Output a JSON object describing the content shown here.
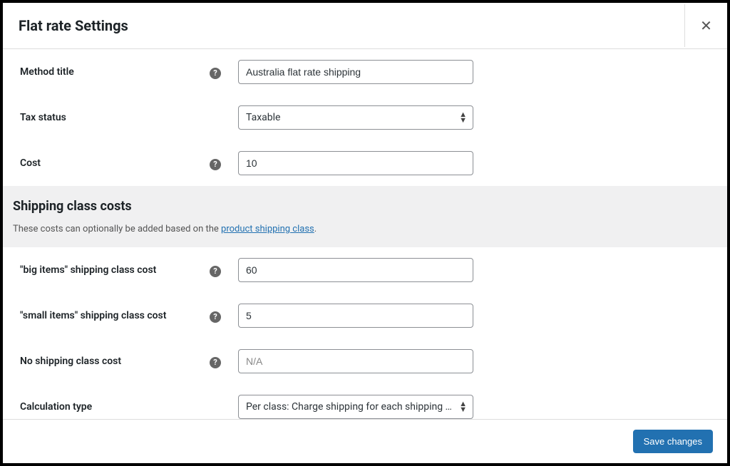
{
  "modal": {
    "title": "Flat rate Settings",
    "close_label": "✕"
  },
  "fields": {
    "method_title": {
      "label": "Method title",
      "value": "Australia flat rate shipping"
    },
    "tax_status": {
      "label": "Tax status",
      "value": "Taxable"
    },
    "cost": {
      "label": "Cost",
      "value": "10"
    }
  },
  "section": {
    "heading": "Shipping class costs",
    "desc_prefix": "These costs can optionally be added based on the ",
    "desc_link": "product shipping class",
    "desc_suffix": "."
  },
  "class_costs": {
    "big": {
      "label": "\"big items\" shipping class cost",
      "value": "60"
    },
    "small": {
      "label": "\"small items\" shipping class cost",
      "value": "5"
    },
    "none": {
      "label": "No shipping class cost",
      "placeholder": "N/A"
    },
    "calc": {
      "label": "Calculation type",
      "value": "Per class: Charge shipping for each shipping class"
    }
  },
  "footer": {
    "save_label": "Save changes"
  },
  "help_glyph": "?"
}
